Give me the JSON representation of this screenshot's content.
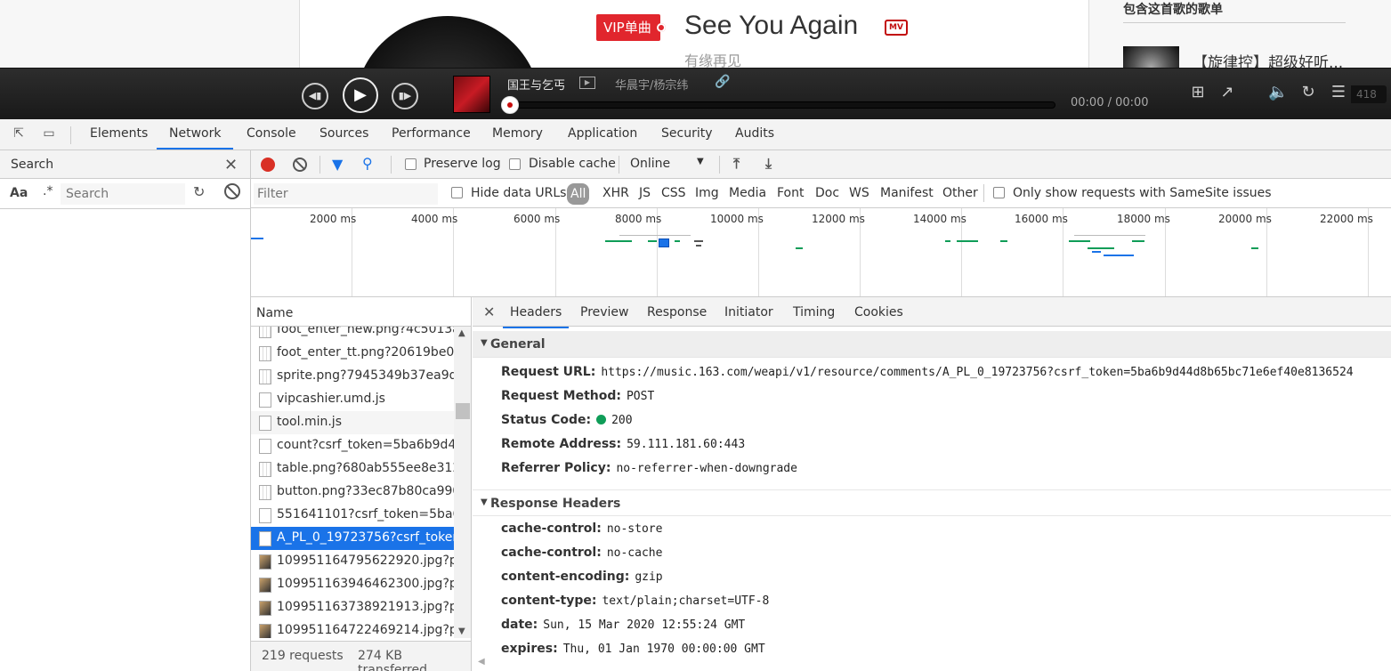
{
  "page": {
    "vip_badge": "VIP单曲",
    "song_title": "See You Again",
    "mv_badge": "MV",
    "song_alias": "有缘再见",
    "side_title": "包含这首歌的歌单",
    "side_item": "【旋律控】超级好听..."
  },
  "player": {
    "track_title": "国王与乞丐",
    "artist": "华晨宇/杨宗纬",
    "time": "00:00 / 00:00",
    "playlist_count": "418"
  },
  "devtools": {
    "tabs": [
      "Elements",
      "Network",
      "Console",
      "Sources",
      "Performance",
      "Memory",
      "Application",
      "Security",
      "Audits"
    ],
    "active_tab": "Network",
    "search": {
      "title": "Search",
      "aa": "Aa",
      "regex": ".*",
      "placeholder": "Search"
    },
    "toolbar": {
      "preserve_log": "Preserve log",
      "disable_cache": "Disable cache",
      "throttle": "Online"
    },
    "filter": {
      "placeholder": "Filter",
      "hide_data_urls": "Hide data URLs",
      "types": [
        "All",
        "XHR",
        "JS",
        "CSS",
        "Img",
        "Media",
        "Font",
        "Doc",
        "WS",
        "Manifest",
        "Other"
      ],
      "samesite": "Only show requests with SameSite issues"
    },
    "overview": {
      "ticks": [
        "2000 ms",
        "4000 ms",
        "6000 ms",
        "8000 ms",
        "10000 ms",
        "12000 ms",
        "14000 ms",
        "16000 ms",
        "18000 ms",
        "20000 ms",
        "22000 ms"
      ]
    },
    "requests": {
      "header": "Name",
      "rows": [
        {
          "name": "foot_enter_new.png?4c5013a",
          "icon": "image-file-icon"
        },
        {
          "name": "foot_enter_tt.png?20619be09",
          "icon": "image-file-icon"
        },
        {
          "name": "sprite.png?7945349b37ea9da",
          "icon": "image-file-icon"
        },
        {
          "name": "vipcashier.umd.js",
          "icon": "script-file-icon"
        },
        {
          "name": "tool.min.js",
          "icon": "script-file-icon"
        },
        {
          "name": "count?csrf_token=5ba6b9d44",
          "icon": "document-file-icon"
        },
        {
          "name": "table.png?680ab555ee8e3121",
          "icon": "image-file-icon"
        },
        {
          "name": "button.png?33ec87b80ca9906",
          "icon": "image-file-icon"
        },
        {
          "name": "551641101?csrf_token=5ba6b",
          "icon": "document-file-icon"
        },
        {
          "name": "A_PL_0_19723756?csrf_token=",
          "icon": "document-file-icon"
        },
        {
          "name": "109951164795622920.jpg?par",
          "icon": "thumbnail-image-icon"
        },
        {
          "name": "109951163946462300.jpg?par",
          "icon": "thumbnail-image-icon"
        },
        {
          "name": "109951163738921913.jpg?par",
          "icon": "thumbnail-image-icon"
        },
        {
          "name": "109951164722469214.jpg?par",
          "icon": "thumbnail-image-icon"
        }
      ],
      "selected_index": 9,
      "summary_requests": "219 requests",
      "summary_transferred": "274 KB transferred"
    },
    "details": {
      "tabs": [
        "Headers",
        "Preview",
        "Response",
        "Initiator",
        "Timing",
        "Cookies"
      ],
      "active_tab": "Headers",
      "general_title": "General",
      "general": [
        {
          "key": "Request URL:",
          "value": "https://music.163.com/weapi/v1/resource/comments/A_PL_0_19723756?csrf_token=5ba6b9d44d8b65bc71e6ef40e8136524"
        },
        {
          "key": "Request Method:",
          "value": "POST"
        },
        {
          "key": "Status Code:",
          "value": "200"
        },
        {
          "key": "Remote Address:",
          "value": "59.111.181.60:443"
        },
        {
          "key": "Referrer Policy:",
          "value": "no-referrer-when-downgrade"
        }
      ],
      "response_title": "Response Headers",
      "response": [
        {
          "key": "cache-control:",
          "value": "no-store"
        },
        {
          "key": "cache-control:",
          "value": "no-cache"
        },
        {
          "key": "content-encoding:",
          "value": "gzip"
        },
        {
          "key": "content-type:",
          "value": "text/plain;charset=UTF-8"
        },
        {
          "key": "date:",
          "value": "Sun, 15 Mar 2020 12:55:24 GMT"
        },
        {
          "key": "expires:",
          "value": "Thu, 01 Jan 1970 00:00:00 GMT"
        }
      ]
    }
  }
}
